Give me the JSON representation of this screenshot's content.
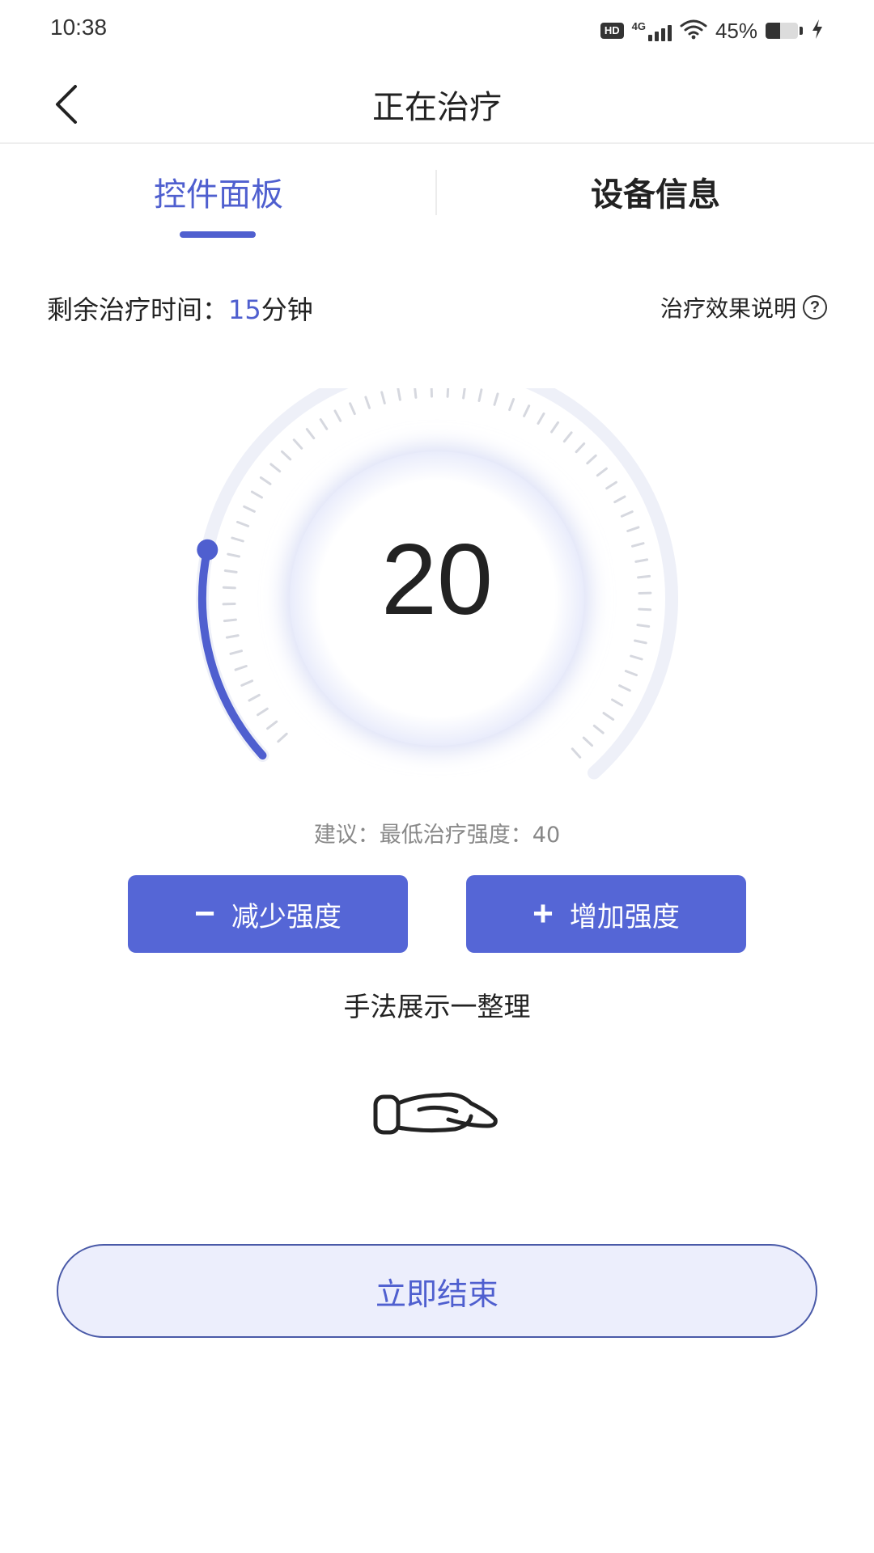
{
  "status_bar": {
    "time": "10:38",
    "hd_label": "HD",
    "network_label": "4G",
    "wifi_icon": "wifi-icon",
    "battery_percent_text": "45%",
    "battery_level": 0.45,
    "charging_icon": "lightning-icon"
  },
  "header": {
    "back_icon": "chevron-left-icon",
    "title": "正在治疗"
  },
  "tabs": [
    {
      "label": "控件面板",
      "active": true
    },
    {
      "label": "设备信息",
      "active": false
    }
  ],
  "info": {
    "remaining_label": "剩余治疗时间：",
    "remaining_value": "15",
    "remaining_unit": "分钟",
    "effect_link": "治疗效果说明",
    "help_icon_glyph": "?"
  },
  "dial": {
    "value": "20",
    "level": 0.2,
    "accent_color": "#4f5fcf"
  },
  "suggestion": "建议：最低治疗强度：40",
  "buttons": {
    "decrease_sign": "−",
    "decrease_label": "减少强度",
    "increase_sign": "+",
    "increase_label": "增加强度"
  },
  "technique_label": "手法展示一整理",
  "technique_icon": "hand-icon",
  "end_button_label": "立即结束",
  "colors": {
    "primary": "#4f5fcf",
    "button": "#5566d6",
    "end_button_bg": "#eceefc"
  }
}
